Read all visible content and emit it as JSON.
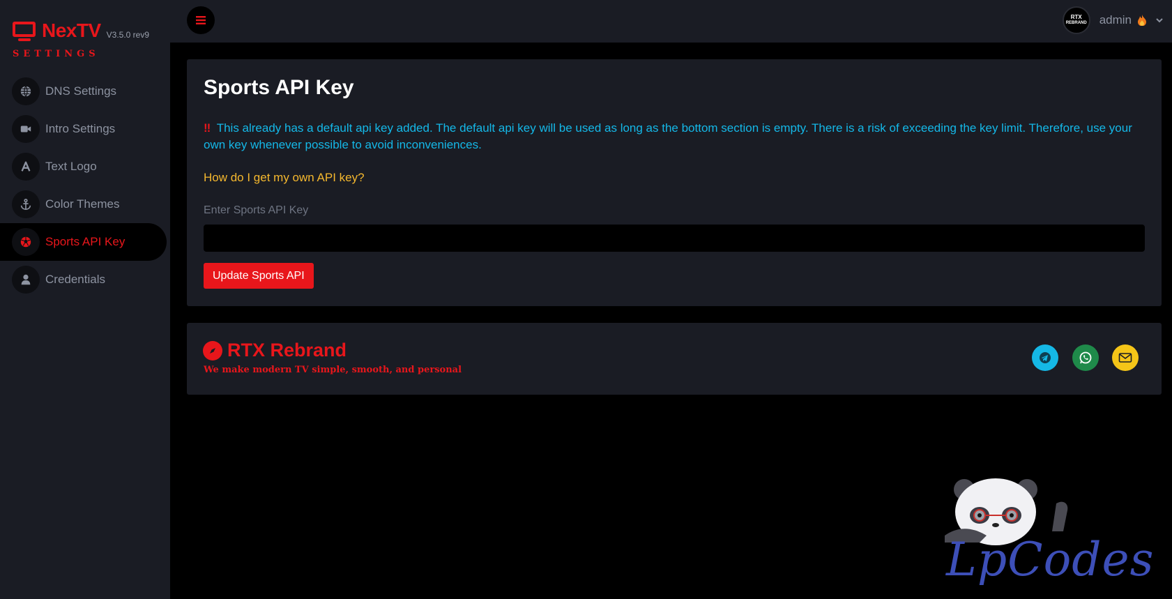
{
  "brand": {
    "name": "NexTV",
    "version": "V3.5.0 rev9",
    "subtitle": "SETTINGS"
  },
  "sidebar": {
    "items": [
      {
        "label": "DNS Settings",
        "icon": "globe-icon"
      },
      {
        "label": "Intro Settings",
        "icon": "video-camera-icon"
      },
      {
        "label": "Text Logo",
        "icon": "letter-a-icon"
      },
      {
        "label": "Color Themes",
        "icon": "anchor-icon"
      },
      {
        "label": "Sports API Key",
        "icon": "soccer-ball-icon",
        "active": true
      },
      {
        "label": "Credentials",
        "icon": "user-icon"
      }
    ]
  },
  "topbar": {
    "avatar_line1": "RTX",
    "avatar_line2": "REBRAND",
    "username": "admin"
  },
  "main": {
    "title": "Sports API Key",
    "notice_mark": "‼",
    "notice": "This already has a default api key added. The default api key will be used as long as the bottom section is empty. There is a risk of exceeding the key limit. Therefore, use your own key whenever possible to avoid inconveniences.",
    "help_link": "How do I get my own API key?",
    "field_label": "Enter Sports API Key",
    "field_value": "",
    "button": "Update Sports API"
  },
  "footer_card": {
    "title": "RTX Rebrand",
    "tagline": "We make modern TV simple, smooth, and personal"
  },
  "watermark": "LpCodes",
  "colors": {
    "accent": "#e8161b",
    "notice": "#14b8e8",
    "link": "#f5b82e",
    "panel": "#1a1c24",
    "background": "#000000"
  }
}
